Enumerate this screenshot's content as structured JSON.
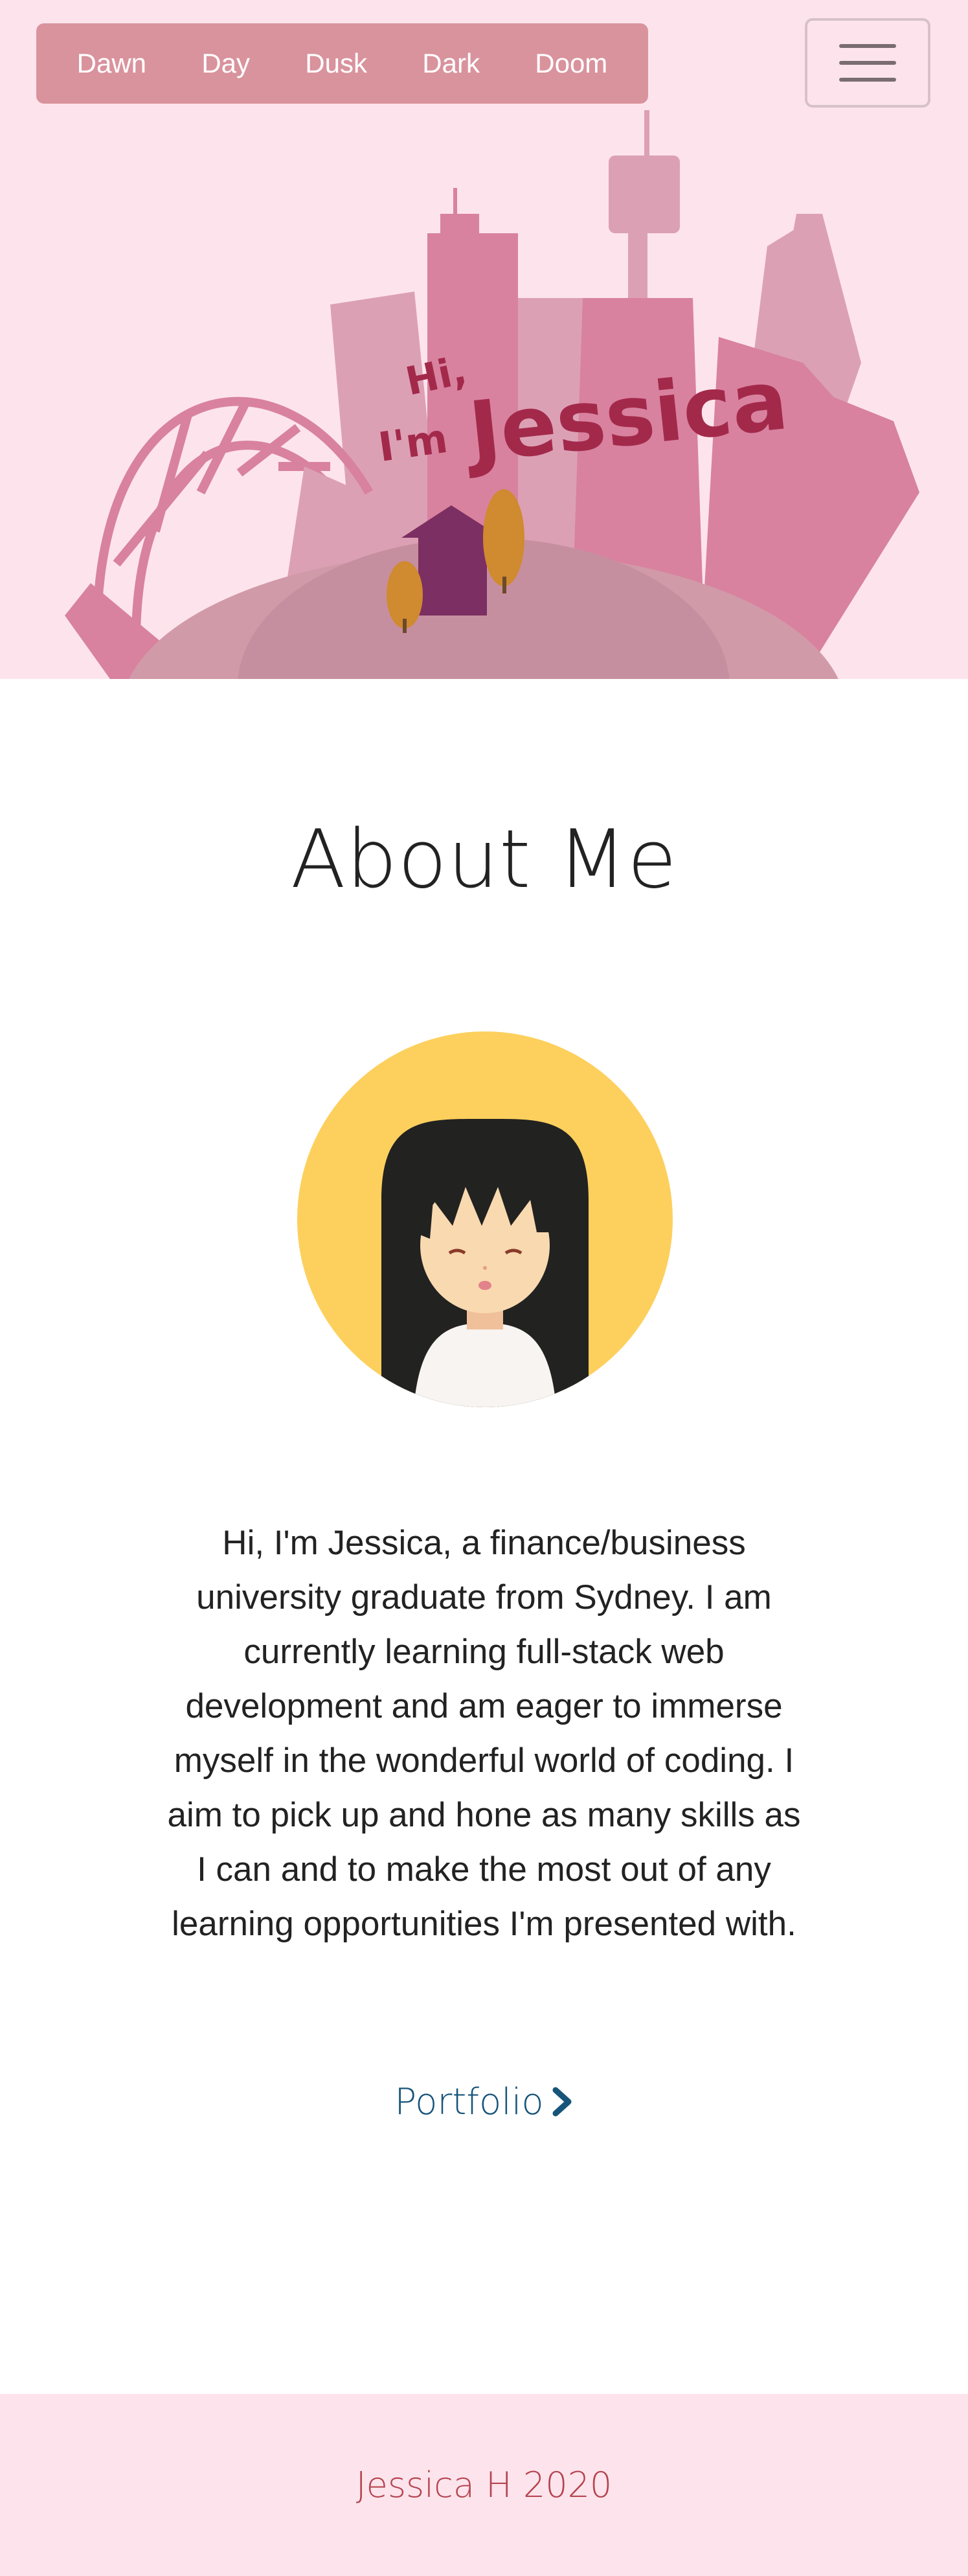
{
  "nav": {
    "themes": [
      "Dawn",
      "Day",
      "Dusk",
      "Dark",
      "Doom"
    ],
    "menu_icon": "hamburger-icon"
  },
  "hero": {
    "greeting_line1": "Hi,",
    "greeting_line2": "I'm",
    "name": "Jessica",
    "colors": {
      "background": "#fde4ec",
      "accent": "#d9939d",
      "house": "#7c2f62",
      "tree": "#d08a2f"
    }
  },
  "about": {
    "title": "About Me",
    "bio": "Hi, I'm Jessica, a finance/business university graduate from Sydney. I am currently learning full-stack web development and am eager to immerse myself in the wonderful world of coding. I aim to pick up and hone as many skills as I can and to make the most out of any learning opportunities I'm presented with.",
    "portfolio_link": "Portfolio",
    "portfolio_icon": "chevron-right-icon"
  },
  "footer": {
    "text": "Jessica H 2020"
  }
}
